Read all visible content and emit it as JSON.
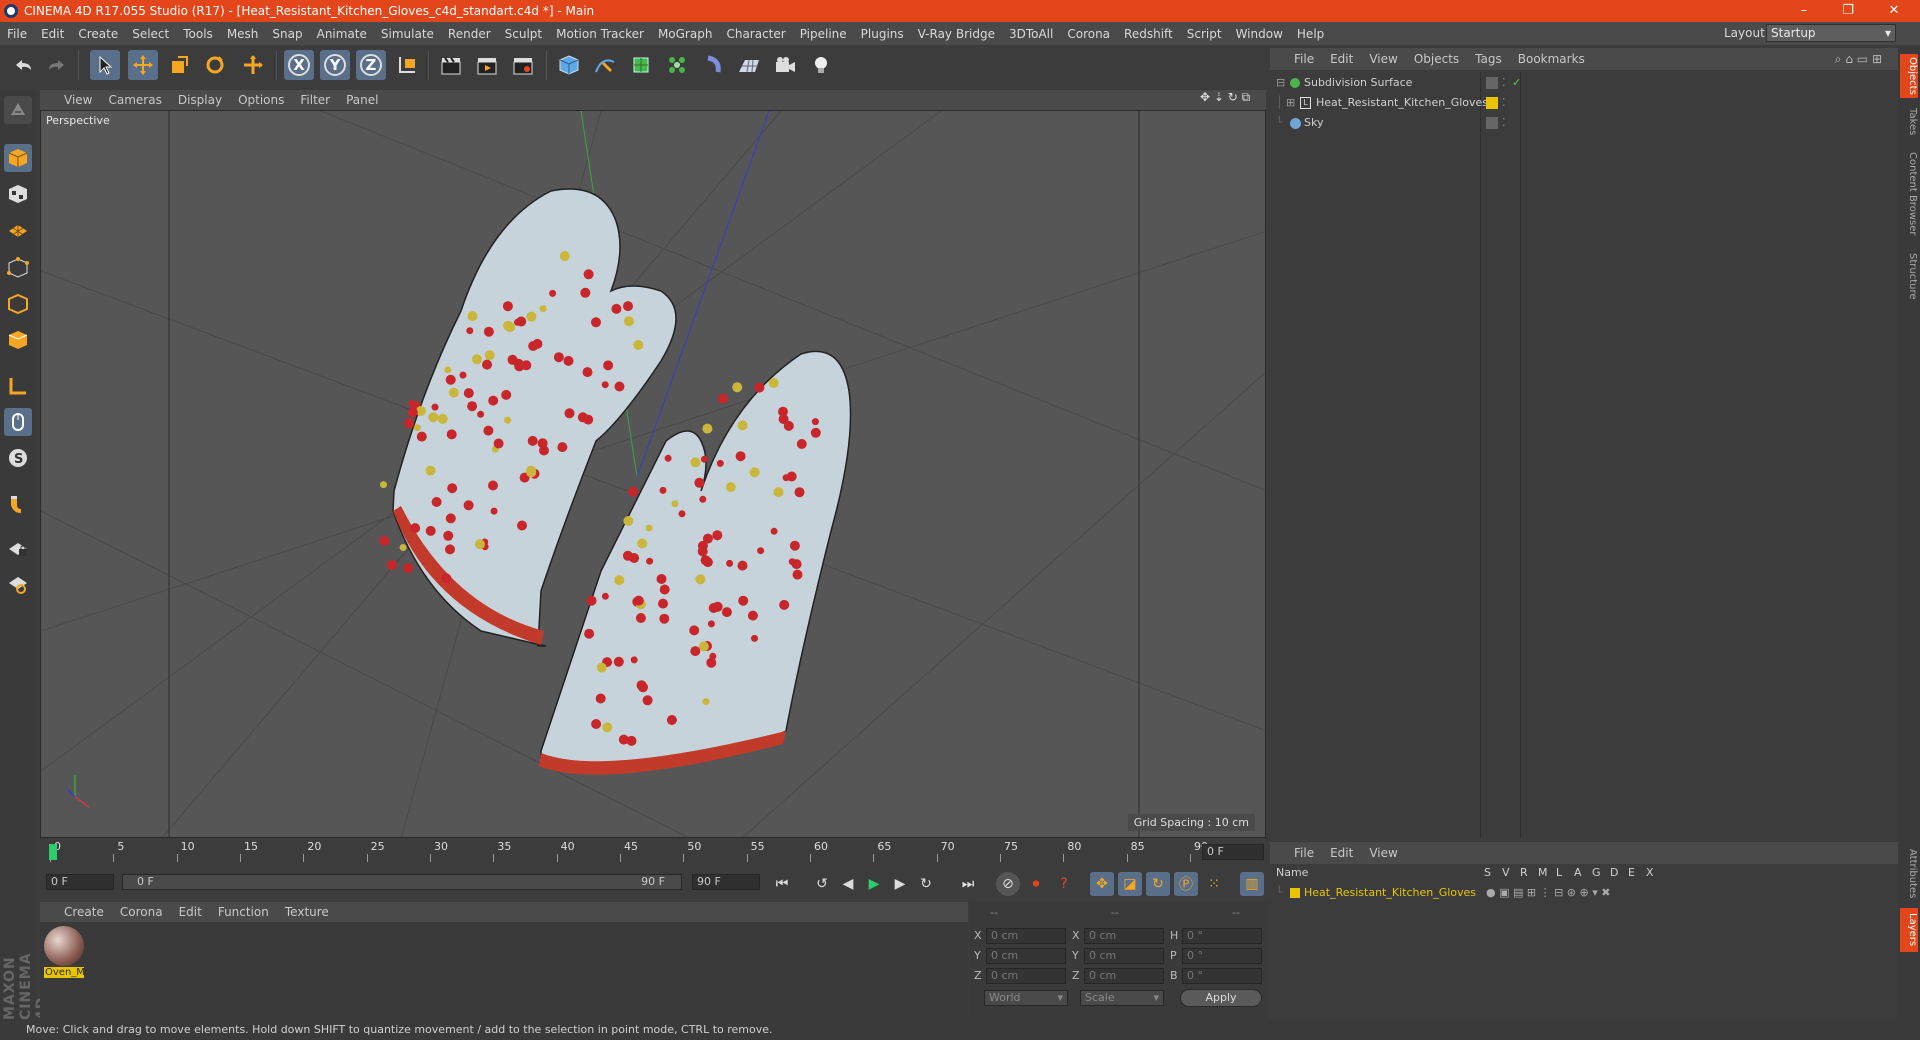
{
  "app": {
    "title": "CINEMA 4D R17.055 Studio (R17) - [Heat_Resistant_Kitchen_Gloves_c4d_standart.c4d *] - Main",
    "window_controls": {
      "minimize": "–",
      "restore": "❐",
      "close": "✕"
    }
  },
  "menu": [
    "File",
    "Edit",
    "Create",
    "Select",
    "Tools",
    "Mesh",
    "Snap",
    "Animate",
    "Simulate",
    "Render",
    "Sculpt",
    "Motion Tracker",
    "MoGraph",
    "Character",
    "Pipeline",
    "Plugins",
    "V-Ray Bridge",
    "3DToAll",
    "Corona",
    "Redshift",
    "Script",
    "Window",
    "Help"
  ],
  "layout": {
    "label": "Layout:",
    "value": "Startup"
  },
  "toolbar": {
    "axis_x": "X",
    "axis_y": "Y",
    "axis_z": "Z"
  },
  "viewport": {
    "menu": [
      "View",
      "Cameras",
      "Display",
      "Options",
      "Filter",
      "Panel"
    ],
    "label": "Perspective",
    "grid_spacing": "Grid Spacing : 10 cm"
  },
  "timeline": {
    "ticks": [
      "0",
      "5",
      "10",
      "15",
      "20",
      "25",
      "30",
      "35",
      "40",
      "45",
      "50",
      "55",
      "60",
      "65",
      "70",
      "75",
      "80",
      "85",
      "90"
    ],
    "current_frame": "0 F",
    "start_field": "0 F",
    "slider_start": "0 F",
    "slider_end": "90 F",
    "end_field": "90 F"
  },
  "materials": {
    "menu": [
      "Create",
      "Corona",
      "Edit",
      "Function",
      "Texture"
    ],
    "items": [
      {
        "name": "Oven_M"
      }
    ]
  },
  "coords": {
    "headers": [
      "--",
      "--",
      "--"
    ],
    "rows": [
      {
        "a": "X",
        "av": "0 cm",
        "b": "X",
        "bv": "0 cm",
        "c": "H",
        "cv": "0 °"
      },
      {
        "a": "Y",
        "av": "0 cm",
        "b": "Y",
        "bv": "0 cm",
        "c": "P",
        "cv": "0 °"
      },
      {
        "a": "Z",
        "av": "0 cm",
        "b": "Z",
        "bv": "0 cm",
        "c": "B",
        "cv": "0 °"
      }
    ],
    "world": "World",
    "scale": "Scale",
    "apply": "Apply"
  },
  "objects": {
    "menu": [
      "File",
      "Edit",
      "View",
      "Objects",
      "Tags",
      "Bookmarks"
    ],
    "items": [
      {
        "name": "Subdivision Surface",
        "color": "#49b54a"
      },
      {
        "name": "Heat_Resistant_Kitchen_Gloves",
        "color": "#e8e8e8"
      },
      {
        "name": "Sky",
        "color": "#6ea6d8"
      }
    ]
  },
  "layers": {
    "menu": [
      "File",
      "Edit",
      "View"
    ],
    "columns": [
      "Name",
      "S",
      "V",
      "R",
      "M",
      "L",
      "A",
      "G",
      "D",
      "E",
      "X"
    ],
    "items": [
      {
        "name": "Heat_Resistant_Kitchen_Gloves",
        "color": "#e8c500"
      }
    ]
  },
  "right_tabs": [
    "Objects",
    "Takes",
    "Content Browser",
    "Structure",
    "Attributes",
    "Layers"
  ],
  "status": "Move: Click and drag to move elements. Hold down SHIFT to quantize movement / add to the selection in point mode, CTRL to remove.",
  "branding": "MAXON CINEMA 4D",
  "colors": {
    "accent": "#e2461a",
    "selected": "#5a6f8a",
    "layer_yellow": "#e8c500"
  }
}
